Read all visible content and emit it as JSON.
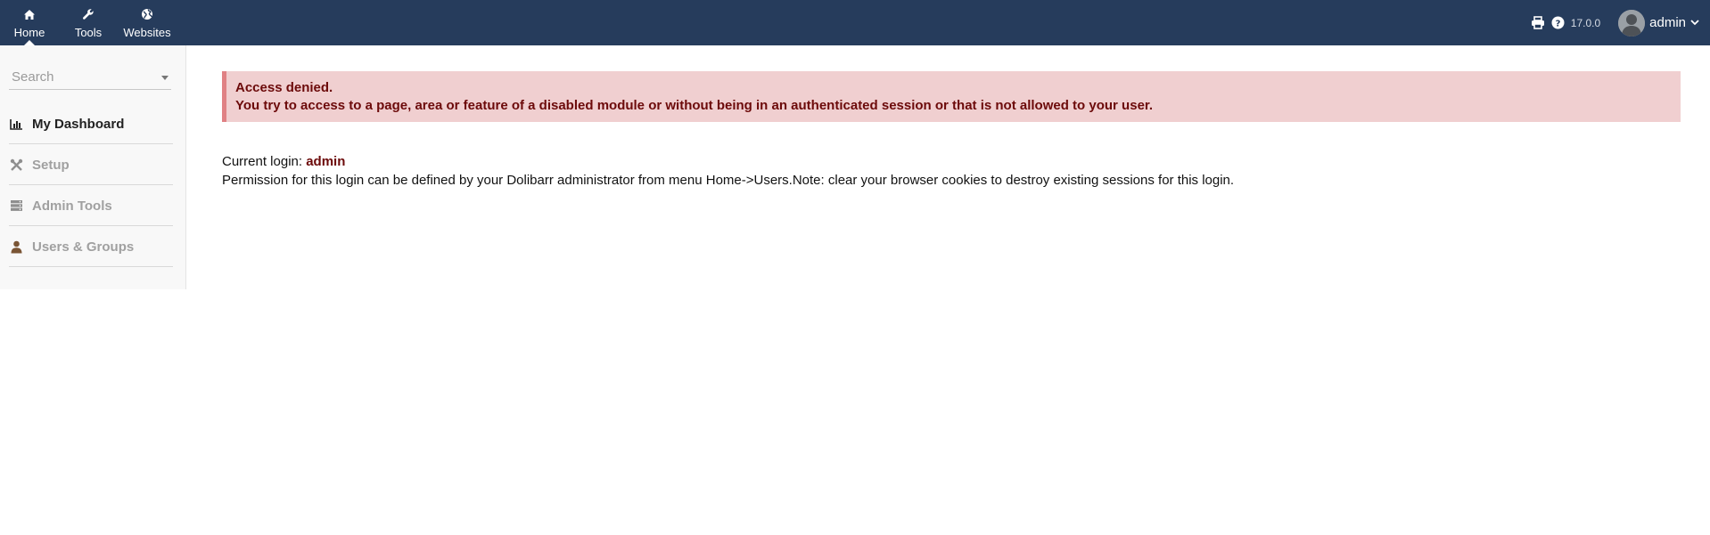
{
  "topnav": {
    "items": [
      {
        "label": "Home",
        "icon": "home-icon",
        "active": true
      },
      {
        "label": "Tools",
        "icon": "wrench-icon",
        "active": false
      },
      {
        "label": "Websites",
        "icon": "globe-icon",
        "active": false
      }
    ]
  },
  "topright": {
    "version": "17.0.0",
    "username": "admin",
    "print_icon": "print-icon",
    "help_icon": "help-icon"
  },
  "leftmenu": {
    "search_placeholder": "Search",
    "items": [
      {
        "label": "My Dashboard",
        "icon": "chart-icon",
        "active": true
      },
      {
        "label": "Setup",
        "icon": "tools-icon",
        "active": false
      },
      {
        "label": "Admin Tools",
        "icon": "server-icon",
        "active": false
      },
      {
        "label": "Users & Groups",
        "icon": "user-icon",
        "active": false
      }
    ]
  },
  "main": {
    "alert_title": "Access denied.",
    "alert_message": "You try to access to a page, area or feature of a disabled module or without being in an authenticated session or that is not allowed to your user.",
    "login_label": "Current login: ",
    "login_user": "admin",
    "permission_text": "Permission for this login can be defined by your Dolibarr administrator from menu Home->Users.Note: clear your browser cookies to destroy existing sessions for this login."
  },
  "colors": {
    "topbar": "#263c5c",
    "alert_bg": "#f0cfd0",
    "alert_border": "#e08184",
    "alert_text": "#6c0a0a"
  }
}
